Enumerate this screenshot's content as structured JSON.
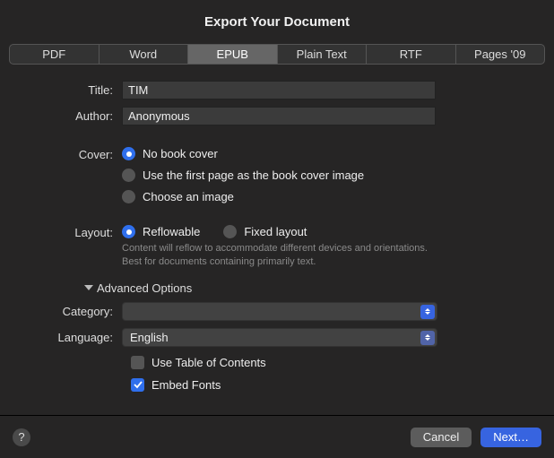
{
  "title": "Export Your Document",
  "tabs": {
    "t0": "PDF",
    "t1": "Word",
    "t2": "EPUB",
    "t3": "Plain Text",
    "t4": "RTF",
    "t5": "Pages '09"
  },
  "labels": {
    "title": "Title:",
    "author": "Author:",
    "cover": "Cover:",
    "layout": "Layout:",
    "category": "Category:",
    "language": "Language:"
  },
  "fields": {
    "title_value": "TIM",
    "author_value": "Anonymous"
  },
  "cover": {
    "no_cover": "No book cover",
    "first_page": "Use the first page as the book cover image",
    "choose": "Choose an image"
  },
  "layout": {
    "reflowable": "Reflowable",
    "fixed": "Fixed layout",
    "hint": "Content will reflow to accommodate different devices and orientations. Best for documents containing primarily text."
  },
  "advanced": "Advanced Options",
  "category_value": "",
  "language_value": "English",
  "checks": {
    "toc": "Use Table of Contents",
    "embed": "Embed Fonts"
  },
  "buttons": {
    "cancel": "Cancel",
    "next": "Next…"
  },
  "help": "?"
}
